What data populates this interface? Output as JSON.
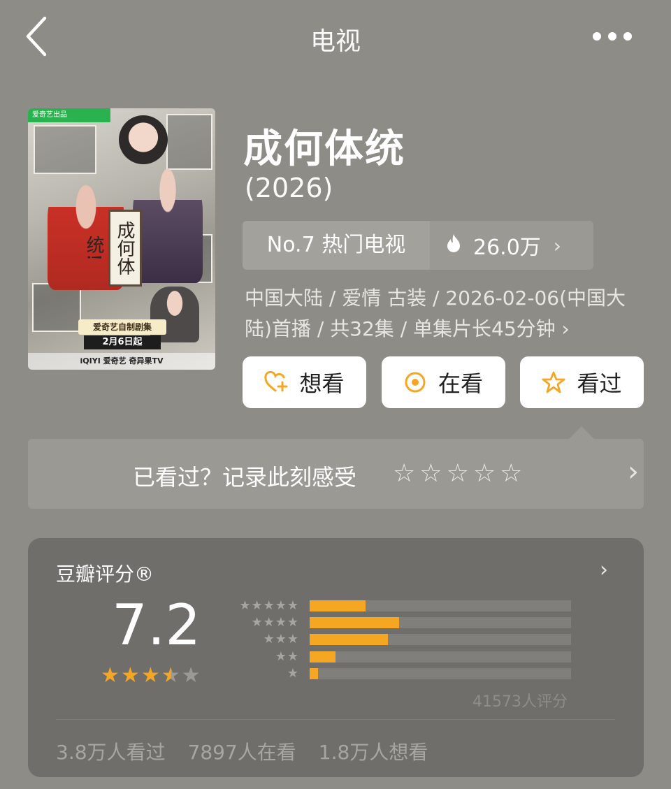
{
  "nav": {
    "title": "电视"
  },
  "poster": {
    "badge": "爱奇艺出品",
    "scroll_text": "成何体统!",
    "self_made_tag": "爱奇艺自制剧集",
    "date_tag": "2月6日起",
    "footer": "iQIYI 爱奇艺  奇异果TV"
  },
  "show": {
    "title": "成何体统",
    "year": "(2026)"
  },
  "rank": {
    "label": "No.7 热门电视",
    "heat": "26.0万",
    "chevron": "›"
  },
  "meta": {
    "line1": "中国大陆 / 爱情 古装 / 2026-02-06(中国大",
    "line2": "陆)首播 / 共32集 / 单集片长45分钟 ›"
  },
  "actions": {
    "want": "想看",
    "watching": "在看",
    "watched": "看过"
  },
  "record": {
    "prompt": "已看过？记录此刻感受",
    "stars": [
      "☆",
      "☆",
      "☆",
      "☆",
      "☆"
    ],
    "chevron": "›"
  },
  "rating": {
    "label": "豆瓣评分®",
    "chevron": "›",
    "score": "7.2",
    "stars_value": 3.5,
    "star_glyphs": [
      "★",
      "★",
      "★",
      "★",
      "★"
    ],
    "distribution": [
      {
        "stars": "★★★★★",
        "percent": 21.5
      },
      {
        "stars": "★★★★",
        "percent": 34.3
      },
      {
        "stars": "★★★",
        "percent": 30.0
      },
      {
        "stars": "★★",
        "percent": 10.0
      },
      {
        "stars": "★",
        "percent": 3.2
      }
    ],
    "count": "41573人评分",
    "watched": "3.8万人看过",
    "watching": "7897人在看",
    "want": "1.8万人想看"
  },
  "colors": {
    "background": "#8d8c87",
    "accent": "#f5a623",
    "card": "#6f6e6a"
  }
}
